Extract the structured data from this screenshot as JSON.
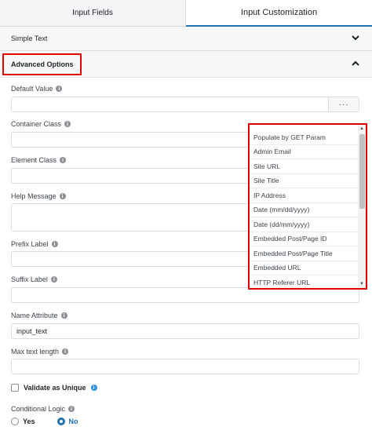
{
  "tabs": {
    "input_fields": "Input Fields",
    "input_customization": "Input Customization"
  },
  "sections": {
    "simple_text": "Simple Text",
    "advanced_options": "Advanced Options"
  },
  "fields": {
    "default_value": "Default Value",
    "container_class": "Container Class",
    "element_class": "Element Class",
    "help_message": "Help Message",
    "prefix_label": "Prefix Label",
    "suffix_label": "Suffix Label",
    "name_attribute": "Name Attribute",
    "name_attribute_value": "input_text",
    "max_text_length": "Max text length",
    "validate_unique": "Validate as Unique",
    "conditional_logic": "Conditional Logic",
    "yes": "Yes",
    "no": "No"
  },
  "more_button": "···",
  "dropdown_items": [
    "Populate by GET Param",
    "Admin Email",
    "Site URL",
    "Site Title",
    "IP Address",
    "Date (mm/dd/yyyy)",
    "Date (dd/mm/yyyy)",
    "Embedded Post/Page ID",
    "Embedded Post/Page Title",
    "Embedded URL",
    "HTTP Referer URL"
  ],
  "icons": {
    "chevron_down": "chevron-down-icon",
    "chevron_up": "chevron-up-icon",
    "info": "info-icon"
  },
  "colors": {
    "accent": "#2271b1",
    "highlight": "#e00000",
    "info_blue": "#2f8fe6"
  }
}
